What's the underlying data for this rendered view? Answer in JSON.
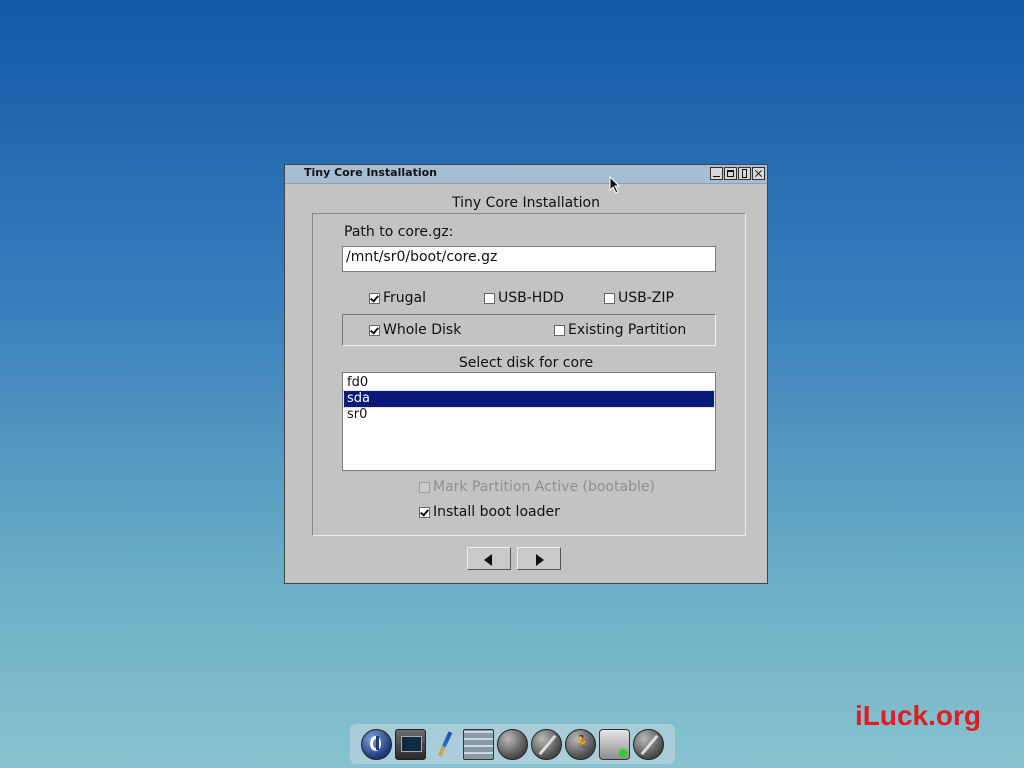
{
  "window": {
    "title": "Tiny Core Installation",
    "heading": "Tiny Core Installation"
  },
  "form": {
    "path_label": "Path to core.gz:",
    "path_value": "/mnt/sr0/boot/core.gz",
    "install_types": [
      {
        "label": "Frugal",
        "checked": true
      },
      {
        "label": "USB-HDD",
        "checked": false
      },
      {
        "label": "USB-ZIP",
        "checked": false
      }
    ],
    "target_options": [
      {
        "label": "Whole Disk",
        "checked": true
      },
      {
        "label": "Existing Partition",
        "checked": false
      }
    ],
    "disk_list_label": "Select disk for core",
    "disks": [
      {
        "name": "fd0",
        "selected": false
      },
      {
        "name": "sda",
        "selected": true
      },
      {
        "name": "sr0",
        "selected": false
      }
    ],
    "mark_active": {
      "label": "Mark Partition Active (bootable)",
      "checked": false,
      "disabled": true
    },
    "install_bootloader": {
      "label": "Install boot loader",
      "checked": true
    }
  },
  "navigation": {
    "prev_icon": "left-arrow-icon",
    "next_icon": "right-arrow-icon"
  },
  "watermark": "iLuck.org",
  "dock": {
    "icons": [
      "power-icon",
      "terminal-icon",
      "paint-brush-icon",
      "control-panel-icon",
      "apps-icon",
      "wand-icon",
      "runner-icon",
      "disk-icon",
      "disabled-icon"
    ]
  }
}
